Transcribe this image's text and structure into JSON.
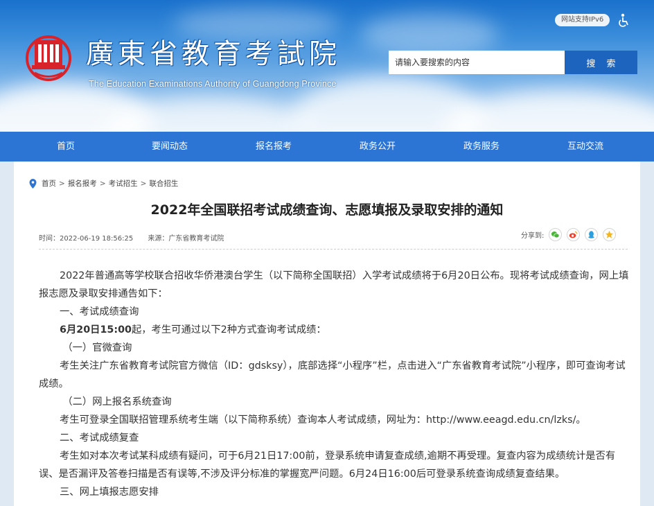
{
  "header": {
    "logo_title": "廣東省教育考試院",
    "logo_subtitle": "The Education Examinations Authority of Guangdong Province",
    "ipv6_badge": "网站支持IPv6",
    "search": {
      "placeholder": "请输入要搜索的内容",
      "button_label": "搜 索"
    }
  },
  "nav": {
    "items": [
      "首页",
      "要闻动态",
      "报名报考",
      "政务公开",
      "政务服务",
      "互动交流"
    ]
  },
  "breadcrumb": [
    "首页",
    "报名报考",
    "考试招生",
    "联合招生"
  ],
  "breadcrumb_sep": ">",
  "article": {
    "title": "2022年全国联招考试成绩查询、志愿填报及录取安排的通知",
    "time": "时间：2022-06-19 18:56:25",
    "source": "来源：广东省教育考试院",
    "share_label": "分享到:",
    "paragraphs": {
      "p1": "2022年普通高等学校联合招收华侨港澳台学生（以下简称全国联招）入学考试成绩将于6月20日公布。现将考试成绩查询，网上填报志愿及录取安排通告如下：",
      "h1": "一、考试成绩查询",
      "p2_bold": "6月20日15:00",
      "p2_rest": "起，考生可通过以下2种方式查询考试成绩：",
      "h1_1": "（一）官微查询",
      "p3": "考生关注广东省教育考试院官方微信（ID：gdsksy），底部选择“小程序”栏，点击进入“广东省教育考试院”小程序，即可查询考试成绩。",
      "h1_2": "（二）网上报名系统查询",
      "p4": "考生可登录全国联招管理系统考生端（以下简称系统）查询本人考试成绩，网址为：http://www.eeagd.edu.cn/lzks/。",
      "h2": "二、考试成绩复查",
      "p5": "考生如对本次考试某科成绩有疑问，可于6月21日17:00前，登录系统申请复查成绩,逾期不再受理。复查内容为成绩统计是否有误、是否漏评及答卷扫描是否有误等,不涉及评分标准的掌握宽严问题。6月24日16:00后可登录系统查询成绩复查结果。",
      "h3": "三、网上填报志愿安排"
    }
  },
  "colors": {
    "nav_bg": "#2c75d4",
    "search_button": "#1d64bf",
    "logo_red": "#d8232a"
  }
}
